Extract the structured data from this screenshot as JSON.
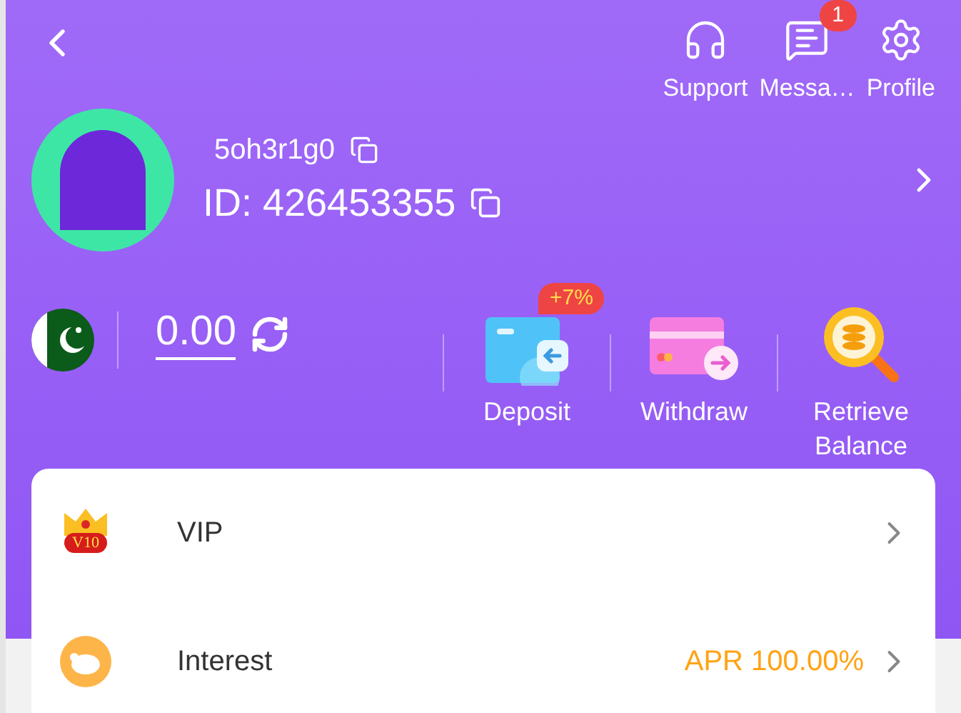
{
  "top_actions": [
    {
      "kind": "support",
      "label": "Support"
    },
    {
      "kind": "messages",
      "label": "Messa…",
      "badge": "1"
    },
    {
      "kind": "profile",
      "label": "Profile"
    }
  ],
  "user": {
    "username": "5oh3r1g0",
    "id": "ID: 426453355"
  },
  "balance": {
    "amount": "0.00"
  },
  "actions": [
    {
      "kind": "deposit",
      "label": "Deposit",
      "badge": "+7%"
    },
    {
      "kind": "withdraw",
      "label": "Withdraw"
    },
    {
      "kind": "retrieve",
      "label": "Retrieve Balance"
    }
  ],
  "menu": [
    {
      "kind": "vip",
      "label": "VIP",
      "icon_text": "V10"
    },
    {
      "kind": "interest",
      "label": "Interest",
      "value": "APR 100.00%"
    }
  ]
}
